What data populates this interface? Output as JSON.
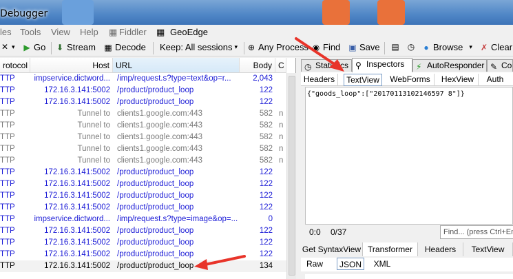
{
  "window": {
    "title": "Debugger"
  },
  "menu": {
    "items": [
      "les",
      "Tools",
      "View",
      "Help",
      "Fiddler",
      "GeoEdge"
    ]
  },
  "toolbar": {
    "go": "Go",
    "stream": "Stream",
    "decode": "Decode",
    "keep": "Keep: All sessions",
    "any_process": "Any Process",
    "find": "Find",
    "save": "Save",
    "browse": "Browse",
    "clear": "Clear"
  },
  "sessions": {
    "columns": {
      "protocol": "rotocol",
      "host": "Host",
      "url": "URL",
      "body": "Body",
      "c": "C"
    },
    "rows": [
      {
        "protocol": "TTP",
        "host": "impservice.dictword...",
        "url": "/imp/request.s?type=text&op=r...",
        "body": "2,043",
        "c": "",
        "style": "blue"
      },
      {
        "protocol": "TTP",
        "host": "172.16.3.141:5002",
        "url": "/product/product_loop",
        "body": "122",
        "c": "",
        "style": "blue"
      },
      {
        "protocol": "TTP",
        "host": "172.16.3.141:5002",
        "url": "/product/product_loop",
        "body": "122",
        "c": "",
        "style": "blue"
      },
      {
        "protocol": "TTP",
        "host": "Tunnel to",
        "url": "clients1.google.com:443",
        "body": "582",
        "c": "n",
        "style": "gray"
      },
      {
        "protocol": "TTP",
        "host": "Tunnel to",
        "url": "clients1.google.com:443",
        "body": "582",
        "c": "n",
        "style": "gray"
      },
      {
        "protocol": "TTP",
        "host": "Tunnel to",
        "url": "clients1.google.com:443",
        "body": "582",
        "c": "n",
        "style": "gray"
      },
      {
        "protocol": "TTP",
        "host": "Tunnel to",
        "url": "clients1.google.com:443",
        "body": "582",
        "c": "n",
        "style": "gray"
      },
      {
        "protocol": "TTP",
        "host": "Tunnel to",
        "url": "clients1.google.com:443",
        "body": "582",
        "c": "n",
        "style": "gray"
      },
      {
        "protocol": "TTP",
        "host": "172.16.3.141:5002",
        "url": "/product/product_loop",
        "body": "122",
        "c": "",
        "style": "blue"
      },
      {
        "protocol": "TTP",
        "host": "172.16.3.141:5002",
        "url": "/product/product_loop",
        "body": "122",
        "c": "",
        "style": "blue"
      },
      {
        "protocol": "TTP",
        "host": "172.16.3.141:5002",
        "url": "/product/product_loop",
        "body": "122",
        "c": "",
        "style": "blue"
      },
      {
        "protocol": "TTP",
        "host": "172.16.3.141:5002",
        "url": "/product/product_loop",
        "body": "122",
        "c": "",
        "style": "blue"
      },
      {
        "protocol": "TTP",
        "host": "impservice.dictword...",
        "url": "/imp/request.s?type=image&op=...",
        "body": "0",
        "c": "",
        "style": "blue"
      },
      {
        "protocol": "TTP",
        "host": "172.16.3.141:5002",
        "url": "/product/product_loop",
        "body": "122",
        "c": "",
        "style": "blue"
      },
      {
        "protocol": "TTP",
        "host": "172.16.3.141:5002",
        "url": "/product/product_loop",
        "body": "122",
        "c": "",
        "style": "blue"
      },
      {
        "protocol": "TTP",
        "host": "172.16.3.141:5002",
        "url": "/product/product_loop",
        "body": "122",
        "c": "",
        "style": "blue"
      },
      {
        "protocol": "TTP",
        "host": "172.16.3.141:5002",
        "url": "/product/product_loop",
        "body": "134",
        "c": "",
        "style": "black"
      }
    ]
  },
  "inspector": {
    "top_tabs": [
      "Statistics",
      "Inspectors",
      "AutoResponder",
      "Co"
    ],
    "request_tabs": [
      "Headers",
      "TextView",
      "WebForms",
      "HexView",
      "Auth"
    ],
    "body_text": "{\"goods_loop\":[\"20170113102146597 8\"]}",
    "status_pos": "0:0",
    "status_len": "0/37",
    "find_placeholder": "Find... (press Ctrl+Ent",
    "response_tabs": [
      "Get SyntaxView",
      "Transformer",
      "Headers",
      "TextView"
    ],
    "response_sub_tabs": [
      "Raw",
      "JSON",
      "XML"
    ]
  },
  "colors": {
    "link_blue": "#1a1ad6",
    "tunnel_gray": "#7a7a7a",
    "annotation_red": "#e8342a"
  }
}
